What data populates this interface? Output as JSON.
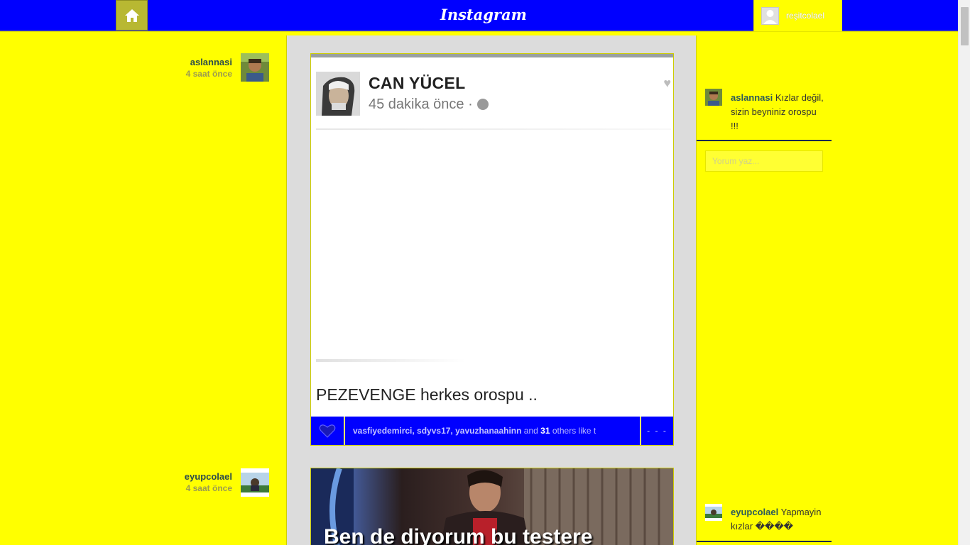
{
  "header": {
    "brand": "Instagram",
    "user": "reşitcolael"
  },
  "feed": [
    {
      "author": "aslannasi",
      "time": "4 saat önce",
      "photo": {
        "fb_name": "CAN YÜCEL",
        "fb_time": "45 dakika önce ·",
        "caption": "PEZEVENGE herkes orospu .."
      },
      "likes": {
        "users": "vasfiyedemirci, sdyvs17, yavuzhanaahinn",
        "and": " and ",
        "count": "31",
        "suffix": " others like t"
      },
      "more": "- - -"
    },
    {
      "author": "eyupcolael",
      "time": "4 saat önce",
      "photo": {
        "caption": "Ben de diyorum bu testere"
      }
    }
  ],
  "comments": [
    {
      "user": "aslannasi",
      "text": " Kızlar değil, sizin beyniniz orospu !!!"
    },
    {
      "user": "eyupcolael",
      "text": " Yapmayin kızlar ����"
    }
  ],
  "comment_input": {
    "placeholder": "Yorum yaz..."
  },
  "colors": {
    "page_bg": "#ffff00",
    "topbar_bg": "#0000ff",
    "column_bg": "#dcdcdc"
  }
}
